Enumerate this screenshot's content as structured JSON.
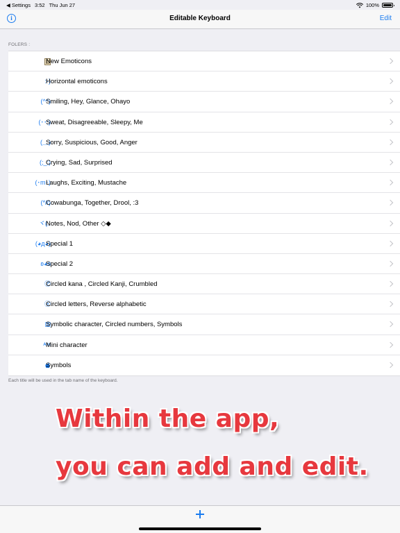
{
  "status_bar": {
    "back_label": "◀ Settings",
    "time": "3:52",
    "date": "Thu Jun 27",
    "battery_text": "100%",
    "battery_level": 1.0
  },
  "nav": {
    "title": "Editable Keyboard",
    "info_label": "i",
    "edit_label": "Edit"
  },
  "section_header": "FOLERS :",
  "rows": [
    {
      "icon": "note-icon",
      "label": "New Emoticons"
    },
    {
      "icon": ":-)",
      "label": "Horizontal emoticons"
    },
    {
      "icon": "(^^)",
      "label": "Smiling, Hey, Glance, Ohayo"
    },
    {
      "icon": "(･･;)",
      "label": "Sweat, Disagreeable, Sleepy, Me"
    },
    {
      "icon": "(＿)",
      "label": "Sorry, Suspicious, Good, Anger"
    },
    {
      "icon": "(;_;)",
      "label": "Crying, Sad, Surprised"
    },
    {
      "icon": "(･m･)",
      "label": "Laughs, Exciting, Mustache"
    },
    {
      "icon": "(*//)",
      "label": "Cowabunga, Together, Drool, :3"
    },
    {
      "icon": "ヾ(..",
      "label": "Notes, Nod, Other ◇◆"
    },
    {
      "icon": "(◕д◕)",
      "label": "Special 1"
    },
    {
      "icon": "ʚ◕ɞ",
      "label": "Special 2"
    },
    {
      "icon": "㋐",
      "label": "Circled kana , Circled Kanji, Crumbled"
    },
    {
      "icon": "ⓐ",
      "label": "Circled letters, Reverse alphabetic"
    },
    {
      "icon": "▥",
      "label": "Symbolic character, Circled numbers, Symbols"
    },
    {
      "icon": "ᴬᵇᶜ",
      "label": "Mini character"
    },
    {
      "icon": "apple-icon",
      "label": "Symbols"
    }
  ],
  "footer_note": "Each title will be used in the tab name of the keyboard.",
  "promo": {
    "line1": "Within the app,",
    "line2": "you can add and edit."
  },
  "toolbar": {
    "add_icon": "plus-icon"
  },
  "colors": {
    "accent": "#1a7bef",
    "promo_text": "#e7383e",
    "background": "#efeff4"
  }
}
